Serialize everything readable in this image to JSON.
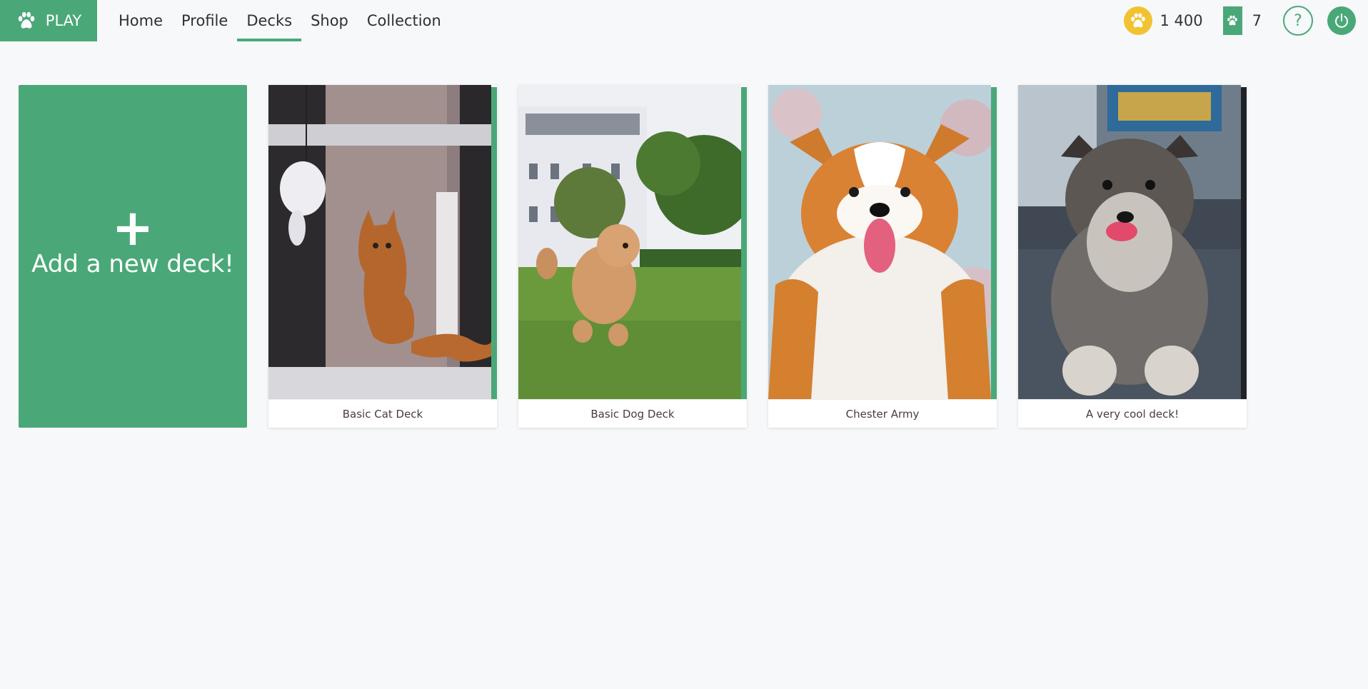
{
  "header": {
    "play_label": "PLAY",
    "nav": [
      {
        "label": "Home",
        "active": false
      },
      {
        "label": "Profile",
        "active": false
      },
      {
        "label": "Decks",
        "active": true
      },
      {
        "label": "Shop",
        "active": false
      },
      {
        "label": "Collection",
        "active": false
      }
    ],
    "coins": "1 400",
    "packs": "7",
    "help_label": "?"
  },
  "add_card": {
    "plus": "+",
    "label": "Add a new deck!"
  },
  "decks": [
    {
      "title": "Basic Cat Deck",
      "spine_color": "#4aa878",
      "image": "cat"
    },
    {
      "title": "Basic Dog Deck",
      "spine_color": "#4aa878",
      "image": "poodle"
    },
    {
      "title": "Chester Army",
      "spine_color": "#4aa878",
      "image": "corgi"
    },
    {
      "title": "A very cool deck!",
      "spine_color": "#1e2228",
      "image": "husky-puppy"
    }
  ],
  "colors": {
    "accent": "#4aa878",
    "coin": "#f2c230"
  }
}
